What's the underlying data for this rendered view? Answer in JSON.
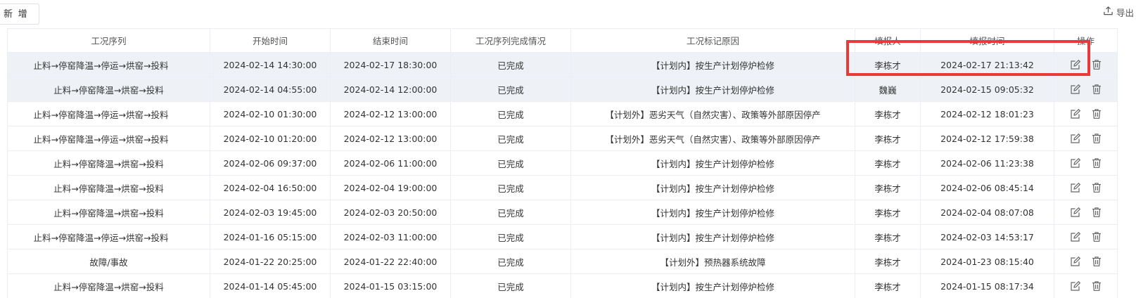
{
  "toolbar": {
    "add_label": "新 增",
    "export_label": "导出",
    "export_icon": "upload-icon"
  },
  "table": {
    "headers": [
      "工况序列",
      "开始时间",
      "结束时间",
      "工况序列完成情况",
      "工况标记原因",
      "填报人",
      "填报时间",
      "操作"
    ],
    "rows": [
      {
        "seq": "止料→停窑降温→停运→烘窑→投料",
        "start": "2024-02-14 14:30:00",
        "end": "2024-02-17 18:30:00",
        "status": "已完成",
        "reason": "【计划内】按生产计划停炉检修",
        "reporter": "李栋才",
        "report_time": "2024-02-17 21:13:42"
      },
      {
        "seq": "止料→停窑降温→烘窑→投料",
        "start": "2024-02-14 04:55:00",
        "end": "2024-02-14 12:00:00",
        "status": "已完成",
        "reason": "【计划内】按生产计划停炉检修",
        "reporter": "魏巍",
        "report_time": "2024-02-15 09:05:32"
      },
      {
        "seq": "止料→停窑降温→停运→烘窑→投料",
        "start": "2024-02-10 01:30:00",
        "end": "2024-02-12 13:00:00",
        "status": "已完成",
        "reason": "【计划外】恶劣天气（自然灾害）、政策等外部原因停产",
        "reporter": "李栋才",
        "report_time": "2024-02-12 18:01:23"
      },
      {
        "seq": "止料→停窑降温→停运→烘窑→投料",
        "start": "2024-02-10 01:20:00",
        "end": "2024-02-12 13:00:00",
        "status": "已完成",
        "reason": "【计划外】恶劣天气（自然灾害）、政策等外部原因停产",
        "reporter": "李栋才",
        "report_time": "2024-02-12 17:59:38"
      },
      {
        "seq": "止料→停窑降温→烘窑→投料",
        "start": "2024-02-06 09:37:00",
        "end": "2024-02-06 11:00:00",
        "status": "已完成",
        "reason": "【计划内】按生产计划停炉检修",
        "reporter": "李栋才",
        "report_time": "2024-02-06 11:23:38"
      },
      {
        "seq": "止料→停窑降温→烘窑→投料",
        "start": "2024-02-04 16:50:00",
        "end": "2024-02-04 19:00:00",
        "status": "已完成",
        "reason": "【计划内】按生产计划停炉检修",
        "reporter": "李栋才",
        "report_time": "2024-02-06 08:45:14"
      },
      {
        "seq": "止料→停窑降温→烘窑→投料",
        "start": "2024-02-03 19:45:00",
        "end": "2024-02-03 20:50:00",
        "status": "已完成",
        "reason": "【计划内】按生产计划停炉检修",
        "reporter": "李栋才",
        "report_time": "2024-02-04 08:07:08"
      },
      {
        "seq": "止料→停窑降温→停运→烘窑→投料",
        "start": "2024-01-16 05:15:00",
        "end": "2024-02-03 11:00:00",
        "status": "已完成",
        "reason": "【计划内】按生产计划停炉检修",
        "reporter": "李栋才",
        "report_time": "2024-02-03 14:53:17"
      },
      {
        "seq": "故障/事故",
        "start": "2024-01-22 20:25:00",
        "end": "2024-01-22 22:40:00",
        "status": "已完成",
        "reason": "【计划外】预热器系统故障",
        "reporter": "李栋才",
        "report_time": "2024-01-23 08:15:40"
      },
      {
        "seq": "止料→停窑降温→烘窑→投料",
        "start": "2024-01-14 05:45:00",
        "end": "2024-01-15 03:15:00",
        "status": "已完成",
        "reason": "【计划内】按生产计划停炉检修",
        "reporter": "李栋才",
        "report_time": "2024-01-15 08:17:34"
      }
    ]
  },
  "colors": {
    "status_done": "#2a9d2a",
    "highlight_border": "#e83a3a",
    "row_highlight_bg": "#eef2f6"
  },
  "icons": {
    "edit": "edit-icon",
    "delete": "trash-icon"
  }
}
